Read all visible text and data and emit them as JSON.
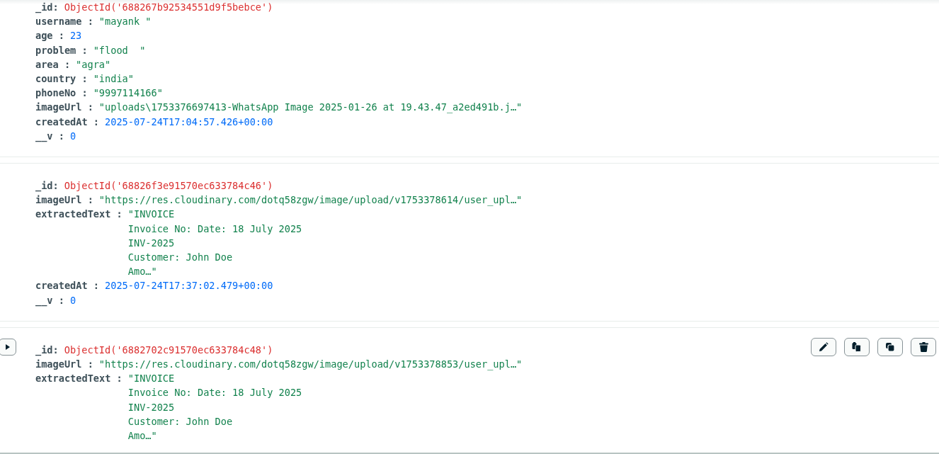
{
  "documents": [
    {
      "hovered": false,
      "fields": [
        {
          "key": "_id:",
          "kind": "objectid",
          "value": "ObjectId('688267b92534551d9f5bebce')"
        },
        {
          "key": "username :",
          "kind": "string",
          "value": "\"mayank \""
        },
        {
          "key": "age :",
          "kind": "number",
          "value": "23"
        },
        {
          "key": "problem :",
          "kind": "string",
          "value": "\"flood  \""
        },
        {
          "key": "area :",
          "kind": "string",
          "value": "\"agra\""
        },
        {
          "key": "country :",
          "kind": "string",
          "value": "\"india\""
        },
        {
          "key": "phoneNo :",
          "kind": "string",
          "value": "\"9997114166\""
        },
        {
          "key": "imageUrl :",
          "kind": "string",
          "value": "\"uploads\\1753376697413-WhatsApp Image 2025-01-26 at 19.43.47_a2ed491b.j…\""
        },
        {
          "key": "createdAt :",
          "kind": "date",
          "value": "2025-07-24T17:04:57.426+00:00"
        },
        {
          "key": "__v :",
          "kind": "number",
          "value": "0"
        }
      ]
    },
    {
      "hovered": false,
      "fields": [
        {
          "key": "_id:",
          "kind": "objectid",
          "value": "ObjectId('68826f3e91570ec633784c46')"
        },
        {
          "key": "imageUrl :",
          "kind": "string",
          "value": "\"https://res.cloudinary.com/dotq58zgw/image/upload/v1753378614/user_upl…\""
        },
        {
          "key": "extractedText :",
          "kind": "multiline",
          "value": "\"INVOICE\nInvoice No: Date: 18 July 2025\nINV-2025\nCustomer: John Doe\nAmo…\""
        },
        {
          "key": "createdAt :",
          "kind": "date",
          "value": "2025-07-24T17:37:02.479+00:00"
        },
        {
          "key": "__v :",
          "kind": "number",
          "value": "0"
        }
      ]
    },
    {
      "hovered": true,
      "fields": [
        {
          "key": "_id:",
          "kind": "objectid",
          "value": "ObjectId('6882702c91570ec633784c48')"
        },
        {
          "key": "imageUrl :",
          "kind": "string",
          "value": "\"https://res.cloudinary.com/dotq58zgw/image/upload/v1753378853/user_upl…\""
        },
        {
          "key": "extractedText :",
          "kind": "multiline",
          "value": "\"INVOICE\nInvoice No: Date: 18 July 2025\nINV-2025\nCustomer: John Doe\nAmo…\""
        }
      ]
    }
  ]
}
